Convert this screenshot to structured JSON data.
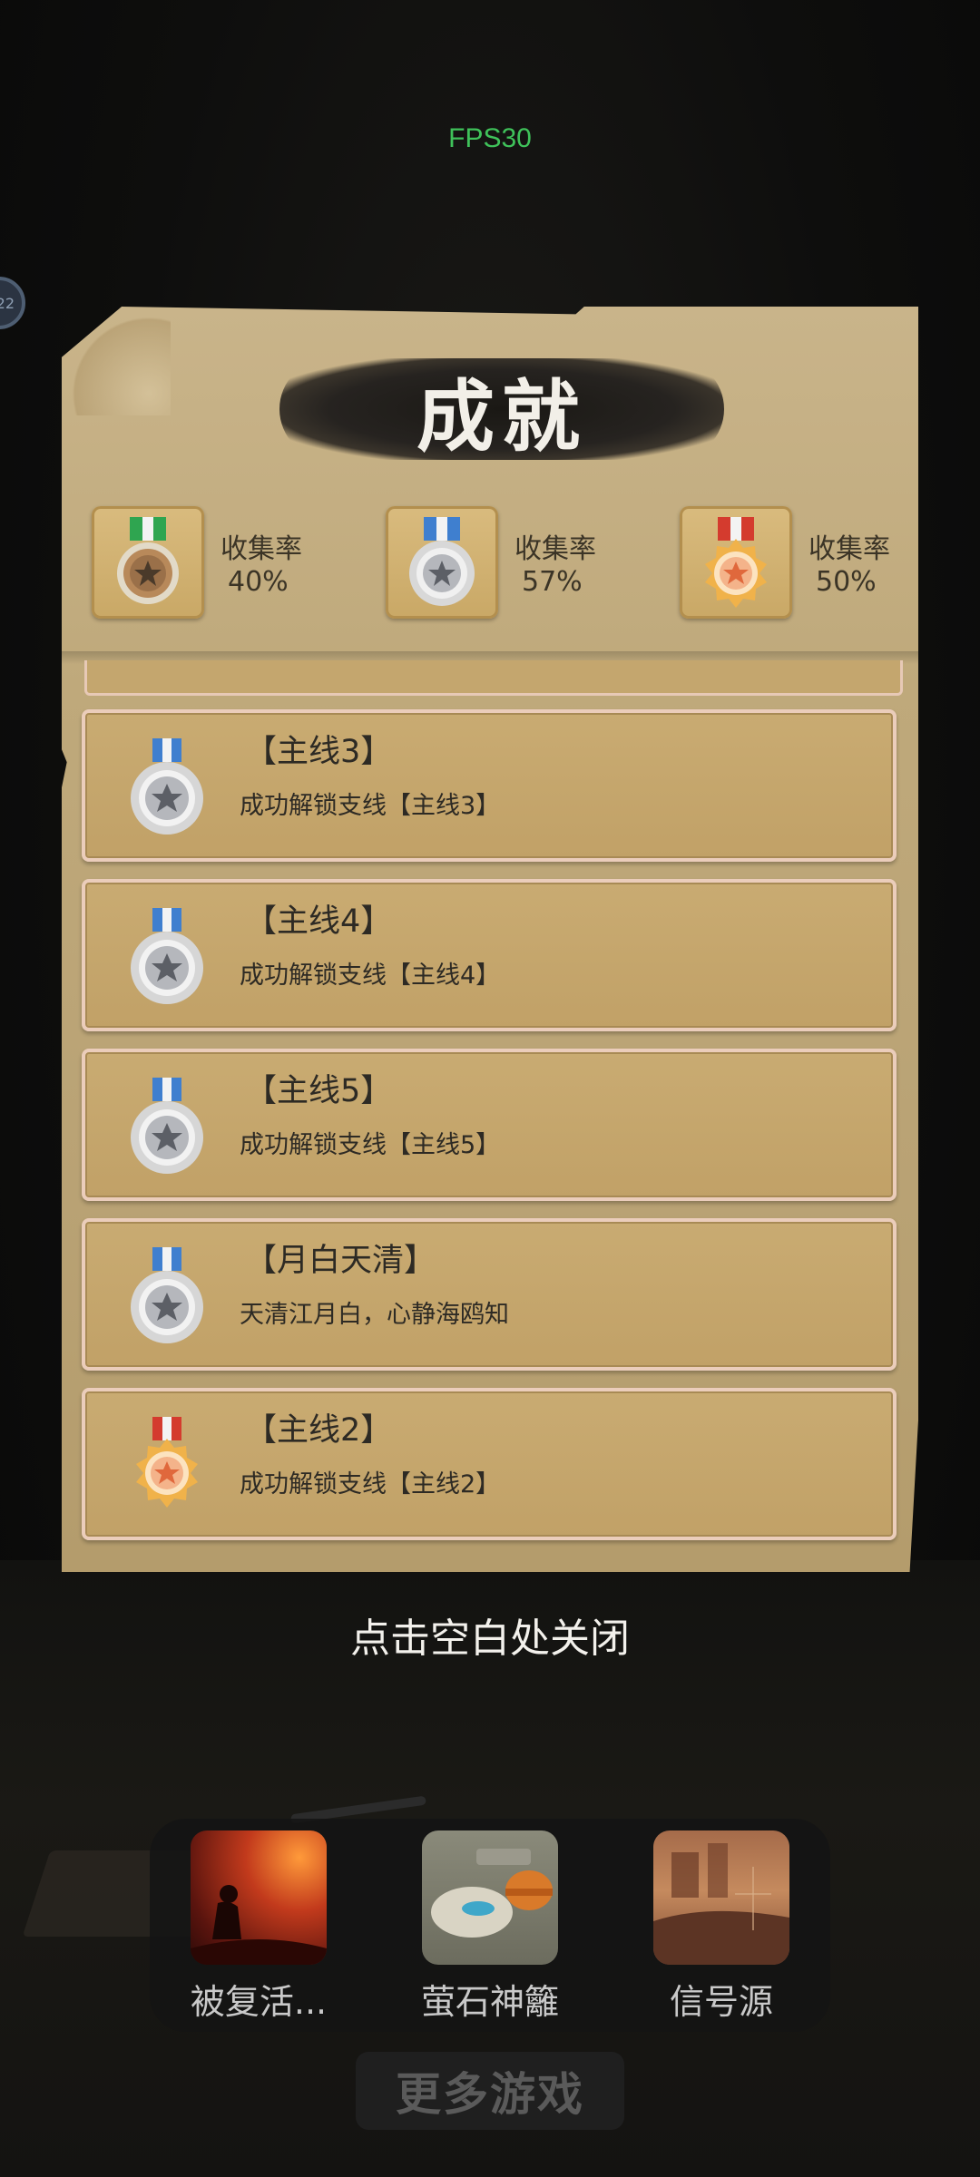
{
  "fps_text": "FPS30",
  "side_badge": "22",
  "title": "成就",
  "stats": [
    {
      "medal": "bronze",
      "label": "收集率",
      "value": "40%"
    },
    {
      "medal": "silver",
      "label": "收集率",
      "value": "57%"
    },
    {
      "medal": "gold",
      "label": "收集率",
      "value": "50%"
    }
  ],
  "achievements": [
    {
      "medal": "silver",
      "title": "【主线3】",
      "desc": "成功解锁支线【主线3】"
    },
    {
      "medal": "silver",
      "title": "【主线4】",
      "desc": "成功解锁支线【主线4】"
    },
    {
      "medal": "silver",
      "title": "【主线5】",
      "desc": "成功解锁支线【主线5】"
    },
    {
      "medal": "silver",
      "title": "【月白天清】",
      "desc": "天清江月白，心静海鸥知"
    },
    {
      "medal": "gold",
      "title": "【主线2】",
      "desc": "成功解锁支线【主线2】"
    }
  ],
  "close_hint": "点击空白处关闭",
  "games": [
    {
      "name": "被复活..."
    },
    {
      "name": "萤石神籬"
    },
    {
      "name": "信号源"
    }
  ],
  "more_games_label": "更多游戏",
  "colors": {
    "fps_green": "#3fc25a",
    "parchment": "#c1a167",
    "card_border": "#ebcdbb"
  }
}
